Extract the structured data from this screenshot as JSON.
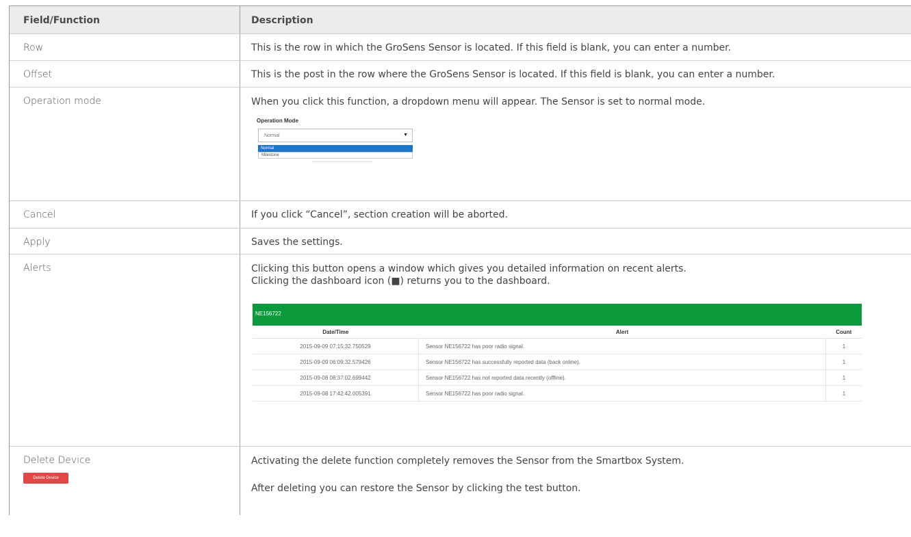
{
  "header": {
    "col1": "Field/Function",
    "col2": "Description"
  },
  "rows": [
    {
      "field": "Row",
      "description": "This is the row in which the GroSens Sensor is located. If this field is blank, you can enter a number."
    },
    {
      "field": "Offset",
      "description": "This is the post in the row where the GroSens Sensor is located. If this field is blank, you can enter a number."
    },
    {
      "field": "Operation mode",
      "description": "When you click this function, a dropdown menu will appear. The Sensor is set to normal mode."
    },
    {
      "field": "Cancel",
      "description": "If you click “Cancel”, section creation will be aborted."
    },
    {
      "field": "Apply",
      "description": "Saves the settings."
    },
    {
      "field": "Alerts",
      "description_line1": "Clicking this button opens a window which gives you detailed information on recent alerts.",
      "description_line2": "Clicking the dashboard icon (■) returns you to the dashboard."
    },
    {
      "field": "Delete Device",
      "description_line1": "Activating the delete function completely removes the Sensor from the Smartbox System.",
      "description_line2": "After deleting you can restore the Sensor by clicking the test button."
    }
  ],
  "operation_mode_mock": {
    "label": "Operation Mode",
    "selected": "Normal",
    "options": [
      "Normal",
      "Milestone"
    ]
  },
  "alerts_mock": {
    "title": "NE156722",
    "columns": [
      "Date/Time",
      "Alert",
      "Count"
    ],
    "rows": [
      [
        "2015-09-09 07:15:32.750529",
        "Sensor NE156722 has poor radio signal.",
        "1"
      ],
      [
        "2015-09-09 06:09:32.579426",
        "Sensor NE156722 has successfully reported data (back online).",
        "1"
      ],
      [
        "2015-09-08 08:37:02.699442",
        "Sensor NE156722 has not reported data recently (offline).",
        "1"
      ],
      [
        "2015-09-08 17:42:42.005391",
        "Sensor NE156722 has poor radio signal.",
        "1"
      ]
    ]
  },
  "delete_button_label": "Delete Device"
}
